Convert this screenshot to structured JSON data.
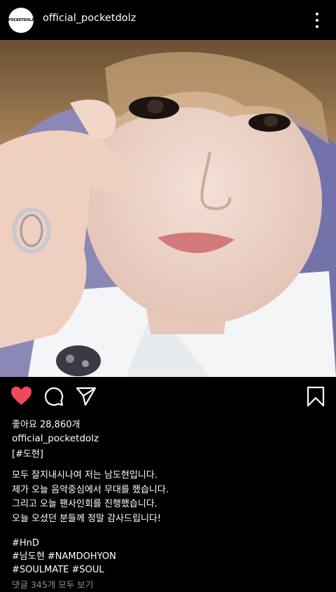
{
  "header": {
    "avatar_text": "POCKETDOLZ",
    "username": "official_pocketdolz",
    "more_icon": "more-vertical-icon"
  },
  "actions": {
    "like_icon": "heart-filled-icon",
    "like_color": "#ed4956",
    "comment_icon": "comment-icon",
    "share_icon": "send-icon",
    "save_icon": "bookmark-icon"
  },
  "post": {
    "likes": "좋아요 28,860개",
    "username": "official_pocketdolz",
    "tag": "[#도현]",
    "lines": [
      "모두 잘지내시나여 저는 남도현입니다.",
      "제가 오늘 음악중심에서 무대를 했습니다.",
      "그리고 오늘 팬사인회를 진행했습니다.",
      "오늘 오셨던 분들께 정말 감사드립니다!"
    ],
    "hashtags": [
      "#HnD",
      "#남도현 #NAMDOHYON",
      "#SOULMATE #SOUL"
    ],
    "comments": "댓글 345개 모두 보기"
  }
}
